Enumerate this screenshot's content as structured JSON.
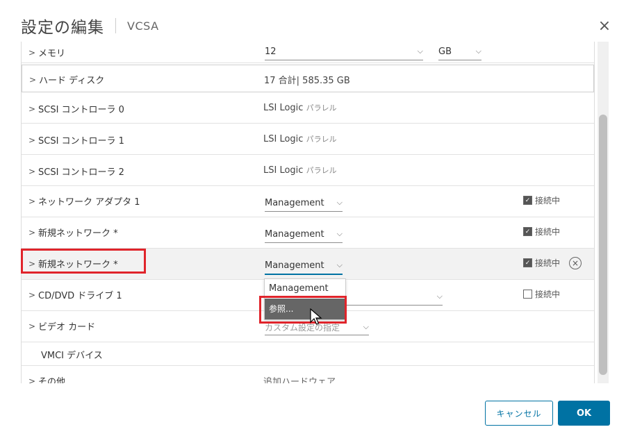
{
  "dialog": {
    "title": "設定の編集",
    "subtitle": "VCSA",
    "close_glyph": "×"
  },
  "rows": [
    {
      "label": "メモリ",
      "value": "12",
      "unit": "GB"
    },
    {
      "label": "ハード ディスク",
      "value": "17 合計| 585.35 GB"
    },
    {
      "label": "SCSI コントローラ 0",
      "value": "LSI Logic",
      "value_suffix": "パラレル"
    },
    {
      "label": "SCSI コントローラ 1",
      "value": "LSI Logic",
      "value_suffix": "パラレル"
    },
    {
      "label": "SCSI コントローラ 2",
      "value": "LSI Logic",
      "value_suffix": "パラレル"
    },
    {
      "label": "ネットワーク アダプタ 1",
      "value": "Management",
      "connected_label": "接続中",
      "connected": true
    },
    {
      "label": "新規ネットワーク *",
      "value": "Management",
      "connected_label": "接続中",
      "connected": true
    },
    {
      "label": "新規ネットワーク *",
      "value": "Management",
      "connected_label": "接続中",
      "connected": true
    },
    {
      "label": "CD/DVD ドライブ 1",
      "value": "",
      "connected_label": "接続中",
      "connected": false
    },
    {
      "label": "ビデオ カード",
      "value": "カスタム設定の指定"
    },
    {
      "label": "VMCI デバイス",
      "value": ""
    },
    {
      "label": "その他",
      "value": "追加ハードウェア"
    }
  ],
  "dropdown": {
    "options": [
      "Management",
      "参照..."
    ]
  },
  "footer": {
    "cancel_label": "キャンセル",
    "ok_label": "OK"
  },
  "colors": {
    "accent": "#0072a3",
    "highlight_box": "#e0242b",
    "dropdown_hover": "#666666"
  }
}
